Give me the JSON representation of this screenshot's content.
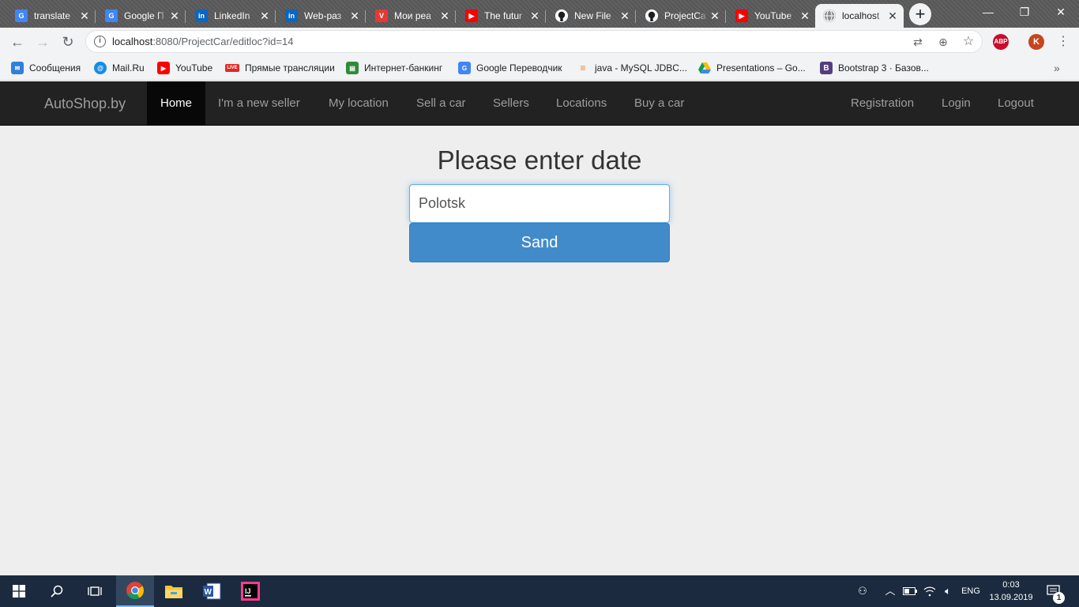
{
  "browser": {
    "tabs": [
      {
        "title": "translate",
        "icon": "google-translate-icon"
      },
      {
        "title": "Google П",
        "icon": "google-translate-icon"
      },
      {
        "title": "LinkedIn",
        "icon": "linkedin-icon"
      },
      {
        "title": "Web-раз",
        "icon": "linkedin-icon"
      },
      {
        "title": "Мои реа",
        "icon": "vivaldi-shield-icon"
      },
      {
        "title": "The futur",
        "icon": "youtube-icon"
      },
      {
        "title": "New File",
        "icon": "github-icon"
      },
      {
        "title": "ProjectCa",
        "icon": "github-icon"
      },
      {
        "title": "YouTube",
        "icon": "youtube-icon"
      },
      {
        "title": "localhost",
        "icon": "globe-icon",
        "active": true
      }
    ],
    "url_host": "localhost",
    "url_rest": ":8080/ProjectCar/editloc?id=14",
    "profile_initial": "K",
    "adblock_label": "ABP",
    "bookmarks": [
      {
        "label": "Сообщения",
        "icon": "messages-icon"
      },
      {
        "label": "Mail.Ru",
        "icon": "mailru-icon"
      },
      {
        "label": "YouTube",
        "icon": "youtube-icon"
      },
      {
        "label": "Прямые трансляции",
        "icon": "live-icon",
        "badge": "LIVE"
      },
      {
        "label": "Интернет-банкинг",
        "icon": "bank-icon"
      },
      {
        "label": "Google Переводчик",
        "icon": "google-translate-icon"
      },
      {
        "label": "java - MySQL JDBC...",
        "icon": "stackoverflow-icon"
      },
      {
        "label": "Presentations – Go...",
        "icon": "google-drive-icon"
      },
      {
        "label": "Bootstrap 3 · Базов...",
        "icon": "bootstrap-icon",
        "badge": "B"
      }
    ]
  },
  "navbar": {
    "brand": "AutoShop.by",
    "items": [
      "Home",
      "I'm a new seller",
      "My location",
      "Sell a car",
      "Sellers",
      "Locations",
      "Buy a car"
    ],
    "right_items": [
      "Registration",
      "Login",
      "Logout"
    ]
  },
  "main": {
    "heading": "Please enter date",
    "input_value": "Polotsk",
    "button_label": "Sand"
  },
  "taskbar": {
    "language": "ENG",
    "time": "0:03",
    "date": "13.09.2019",
    "notification_count": "1"
  },
  "colors": {
    "navbar_bg": "#222222",
    "nav_active_bg": "#080808",
    "button_bg": "#428bca",
    "page_bg": "#eeeeee",
    "taskbar_bg": "#1b2a3e"
  }
}
